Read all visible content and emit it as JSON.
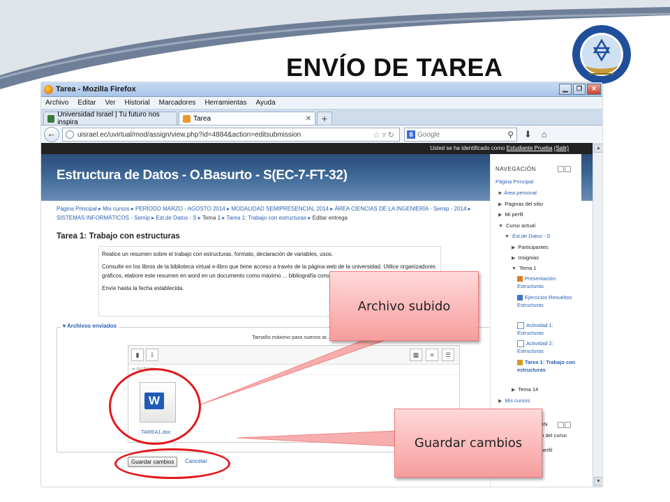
{
  "slide": {
    "title": "ENVÍO DE TAREA"
  },
  "browser": {
    "window_title": "Tarea - Mozilla Firefox",
    "menu": [
      "Archivo",
      "Editar",
      "Ver",
      "Historial",
      "Marcadores",
      "Herramientas",
      "Ayuda"
    ],
    "tabs": [
      {
        "label": "Universidad Israel | Tu futuro nos inspira",
        "active": false
      },
      {
        "label": "Tarea",
        "active": true
      }
    ],
    "url": "uisrael.ec/uvirtual/mod/assign/view.php?id=4884&action=editsubmission",
    "search_engine": "Google",
    "search_placeholder": "Google"
  },
  "page": {
    "userbar": {
      "prefix": "Usted se ha identificado como",
      "user": "Estudiante Prueba",
      "logout": "(Salir)"
    },
    "course_title": "Estructura de Datos - O.Basurto - S(EC-7-FT-32)",
    "breadcrumb": [
      "Página Principal",
      "Mis cursos",
      "PERÍODO MARZO - AGOSTO 2014",
      "MODALIDAD SEMIPRESENCIAL 2014",
      "ÁREA CIENCIAS DE LA INGENIERÍA - Semip - 2014",
      "SISTEMAS INFORMÁTICOS - Semip",
      "Est.de Datos - S",
      "Tema 1",
      "Tarea 1: Trabajo con estructuras",
      "Editar entrega"
    ],
    "task_title": "Tarea 1: Trabajo con estructuras",
    "intro": [
      "Realice un resumen sobre el trabajo con estructuras, formato, declaración de variables, usos.",
      "Consulte en los libros de la biblioteca virtual e-libro que tiene acceso a través de la página web de la universidad. Utilice organizadores gráficos, elabore este resumen en word en un documento como máximo ... bibliografía consultada.",
      "Envíe hasta la fecha establecida."
    ],
    "files_legend": "Archivos enviados",
    "max_size_text": "Tamaño máximo para nuevos ar...",
    "file_path": "Archivos",
    "file_name": "TAREA1.doc",
    "save_label": "Guardar cambios",
    "cancel_label": "Cancelar"
  },
  "sidebar": {
    "nav_title": "NAVEGACIÓN",
    "items": {
      "home": "Página Principal",
      "personal": "Área personal",
      "site_pages": "Páginas del sitio",
      "profile": "Mi perfil",
      "current_course": "Curso actual",
      "course": "Est.de Datos - S",
      "participants": "Participantes",
      "badges": "Insignias",
      "tema1": "Tema 1",
      "presentacion": "Presentación: Estructuras",
      "ejercicios": "Ejercicios Resueltos Estructuras",
      "actividad1": "Actividad 1: Estructuras",
      "actividad2": "Actividad 2: Estructuras",
      "tarea1": "Tarea 1: Trabajo con estructuras",
      "tema14": "Tema 14",
      "mis_cursos": "Mis cursos"
    },
    "admin_title": "...ÓN",
    "admin_item1": "...n del curso",
    "admin_item2": "perfil"
  },
  "annotations": {
    "uploaded": "Archivo subido",
    "save": "Guardar cambios"
  },
  "colors": {
    "accent_red": "#e3171c",
    "link_blue": "#2a5fb0",
    "banner": "#2b4d79"
  }
}
